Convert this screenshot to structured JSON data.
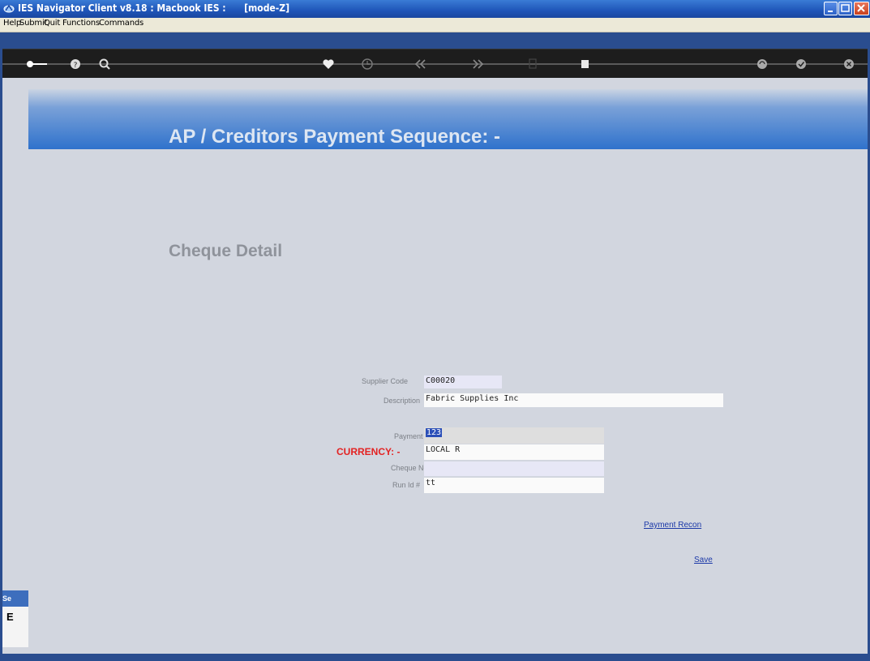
{
  "window": {
    "title": "IES Navigator Client v8.18 : Macbook IES :      [mode-Z]"
  },
  "menu": [
    "Help",
    "Submit",
    "Quit",
    "Functions",
    "Commands"
  ],
  "toolbar_icons": [
    "key-icon",
    "help-icon",
    "search-icon",
    "heart-icon",
    "clock-icon",
    "rewind-icon",
    "fast-forward-icon",
    "document-icon",
    "stop-icon",
    "recycle-icon",
    "check-icon",
    "close-icon"
  ],
  "banner": {
    "title": "AP / Creditors Payment Sequence: -"
  },
  "section": {
    "title": "Cheque Detail"
  },
  "form": {
    "supplier_code": {
      "label": "Supplier Code",
      "value": "C00020"
    },
    "description": {
      "label": "Description",
      "value": "Fabric Supplies Inc"
    },
    "payment": {
      "label": "Payment",
      "value": "123"
    },
    "currency": {
      "label": "CURRENCY: -",
      "value": "LOCAL R"
    },
    "cheque_no": {
      "label": "Cheque No",
      "value": ""
    },
    "run_id": {
      "label": "Run Id #",
      "value": "tt"
    }
  },
  "links": {
    "payment_recon": "Payment Recon",
    "save": "Save"
  },
  "side_stub": {
    "tab": "Se",
    "char": "E"
  },
  "colors": {
    "titlebar": "#1f55b8",
    "banner": "#2f72cc",
    "background": "#d2d6df",
    "currency_label": "#e32222",
    "link": "#1c39a8"
  }
}
